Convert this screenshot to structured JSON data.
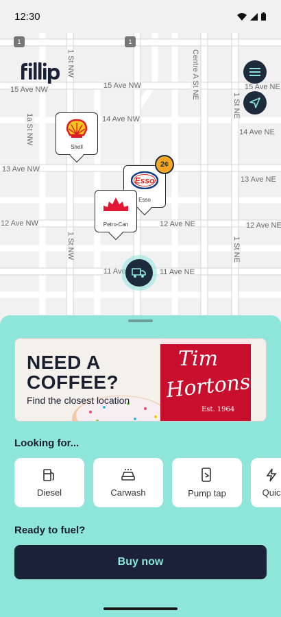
{
  "status_bar": {
    "time": "12:30"
  },
  "app": {
    "logo_text": "fillip"
  },
  "map": {
    "streets": [
      "15 Ave NW",
      "15 Ave NW",
      "15 Ave NE",
      "14 Ave NW",
      "14 Ave NE",
      "13 Ave NW",
      "13 Ave NE",
      "12 Ave NW",
      "12 Ave NE",
      "12 Ave NE",
      "11 Ave NW",
      "11 Ave NE",
      "1 St NW",
      "1a St NW",
      "1 St NW",
      "Centre A St NE",
      "1 St NE",
      "1 St NE"
    ],
    "highway_shields": [
      "1",
      "1"
    ],
    "stations": [
      {
        "name": "Shell"
      },
      {
        "name": "Esso",
        "price_badge": "2¢"
      },
      {
        "name": "Petro-Can"
      }
    ]
  },
  "sheet": {
    "banner": {
      "title": "NEED A COFFEE?",
      "subtitle": "Find the closest location",
      "brand_line1": "Tim",
      "brand_line2": "Hortons",
      "brand_est": "Est. 1964"
    },
    "looking_for_title": "Looking for...",
    "services": [
      {
        "label": "Diesel",
        "icon": "fuel-pump-icon"
      },
      {
        "label": "Carwash",
        "icon": "car-icon"
      },
      {
        "label": "Pump tap",
        "icon": "phone-tap-icon"
      },
      {
        "label": "Quic",
        "icon": "quick-icon"
      }
    ],
    "ready_title": "Ready to fuel?",
    "buy_button": "Buy now"
  },
  "colors": {
    "accent": "#8de6d9",
    "navy": "#1b2238",
    "badge": "#f5a623"
  }
}
